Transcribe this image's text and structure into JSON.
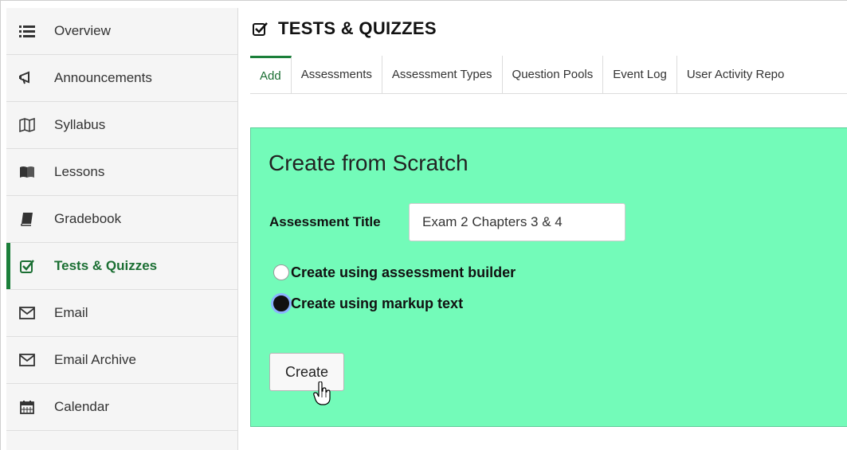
{
  "sidebar": {
    "items": [
      {
        "label": "Overview",
        "icon": "list-icon"
      },
      {
        "label": "Announcements",
        "icon": "megaphone-icon"
      },
      {
        "label": "Syllabus",
        "icon": "map-icon"
      },
      {
        "label": "Lessons",
        "icon": "book-open-icon"
      },
      {
        "label": "Gradebook",
        "icon": "book-icon"
      },
      {
        "label": "Tests & Quizzes",
        "icon": "checkbox-icon",
        "active": true
      },
      {
        "label": "Email",
        "icon": "envelope-icon"
      },
      {
        "label": "Email Archive",
        "icon": "envelope-icon"
      },
      {
        "label": "Calendar",
        "icon": "calendar-icon"
      }
    ]
  },
  "tool": {
    "title": "TESTS & QUIZZES",
    "icon": "checkbox-icon"
  },
  "tabs": [
    {
      "label": "Add",
      "active": true
    },
    {
      "label": "Assessments"
    },
    {
      "label": "Assessment Types"
    },
    {
      "label": "Question Pools"
    },
    {
      "label": "Event Log"
    },
    {
      "label": "User Activity Repo"
    }
  ],
  "panel": {
    "title": "Create from Scratch",
    "field_label": "Assessment Title",
    "title_value": "Exam 2 Chapters 3 & 4",
    "options": [
      {
        "label": "Create using assessment builder",
        "checked": false
      },
      {
        "label": "Create using markup text",
        "checked": true
      }
    ],
    "create_button": "Create"
  },
  "colors": {
    "accent": "#1b7f3a",
    "panel_bg": "#73fbb9",
    "sidebar_bg": "#f5f5f5"
  }
}
